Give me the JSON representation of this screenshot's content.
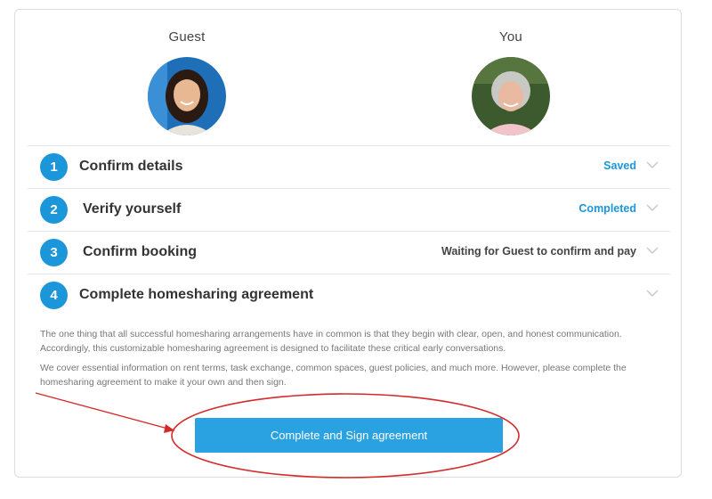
{
  "guest": {
    "label": "Guest",
    "avatar_icon": "guest-avatar"
  },
  "you": {
    "label": "You",
    "avatar_icon": "user-avatar"
  },
  "steps": [
    {
      "number": "1",
      "title": "Confirm details",
      "status": "Saved",
      "status_color": "#1b96d9"
    },
    {
      "number": "2",
      "title": "Verify yourself",
      "status": "Completed",
      "status_color": "#1b96d9"
    },
    {
      "number": "3",
      "title": "Confirm booking",
      "status": "Waiting for Guest to confirm and pay",
      "status_color": "#444444"
    },
    {
      "number": "4",
      "title": "Complete homesharing agreement",
      "status": ""
    }
  ],
  "agreement": {
    "paragraph_1": "The one thing that all successful homesharing arrangements have in common is that they begin with clear, open, and honest communication. Accordingly, this customizable homesharing agreement is designed to facilitate these critical early conversations.",
    "paragraph_2": "We cover essential information on rent terms, task exchange, common spaces, guest policies, and much more. However, please complete the homesharing agreement to make it your own and then sign.",
    "button_label": "Complete and Sign agreement"
  },
  "colors": {
    "accent": "#1b96d9",
    "button": "#2aa1e0",
    "annotation": "#d42a2a"
  }
}
